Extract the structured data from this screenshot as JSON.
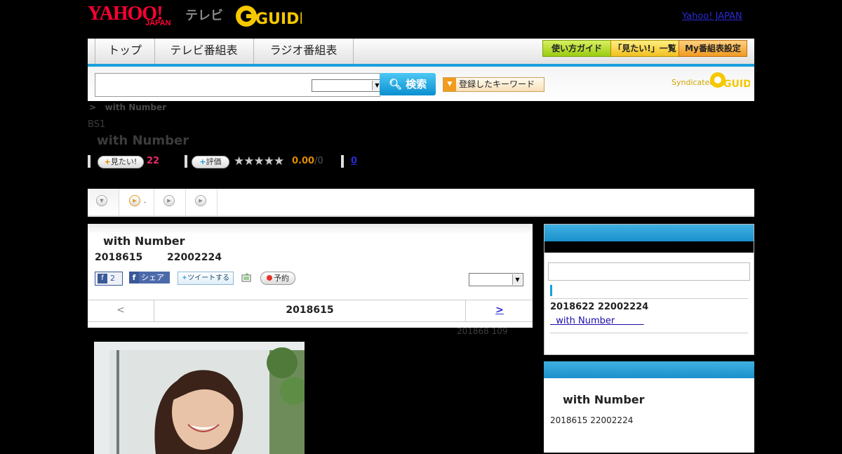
{
  "header": {
    "yahoo_logo": "YAHOO!",
    "japan_logo": "JAPAN",
    "tv_logo": "テレビ",
    "gguide_logo": "G-GUIDE",
    "yahoo_japan_link": "Yahoo! JAPAN"
  },
  "nav": {
    "tabs": [
      "トップ",
      "テレビ番組表",
      "ラジオ番組表"
    ],
    "right_buttons": [
      "使い方ガイド",
      "「見たい!」一覧",
      "My番組表設定"
    ]
  },
  "search": {
    "button_label": "検索",
    "keyword_button": "登録したキーワード",
    "syndicated": "Syndicated"
  },
  "program": {
    "breadcrumb_sep": ">",
    "breadcrumb": "with Number",
    "channel": "BS1",
    "title": "with Number",
    "want_label": "見たい!",
    "want_count": "22",
    "rate_label": "評価",
    "stars": "★★★★★",
    "rating": "0.00",
    "rating_of": "/0",
    "comment_count": "0"
  },
  "tabs": {
    "second_label": "."
  },
  "main": {
    "title": "with Number",
    "date": "2018615",
    "time": "22002224",
    "like_count": "2",
    "share_label": "シェア",
    "tweet_label": "ツイートする",
    "reserve_label": "予約",
    "nav_prev": "<",
    "nav_date": "2018615",
    "nav_next": ">",
    "updated": "201868  109"
  },
  "sidebar": {
    "entry_date": "2018622  22002224",
    "entry_link": "  with Number          ",
    "box2_title": "with Number",
    "box2_sub": "2018615  22002224"
  },
  "colors": {
    "accent_blue": "#1aa0dd",
    "want_pink": "#e8286e",
    "rating_orange": "#e08a00",
    "brand_red": "#ff0033"
  }
}
